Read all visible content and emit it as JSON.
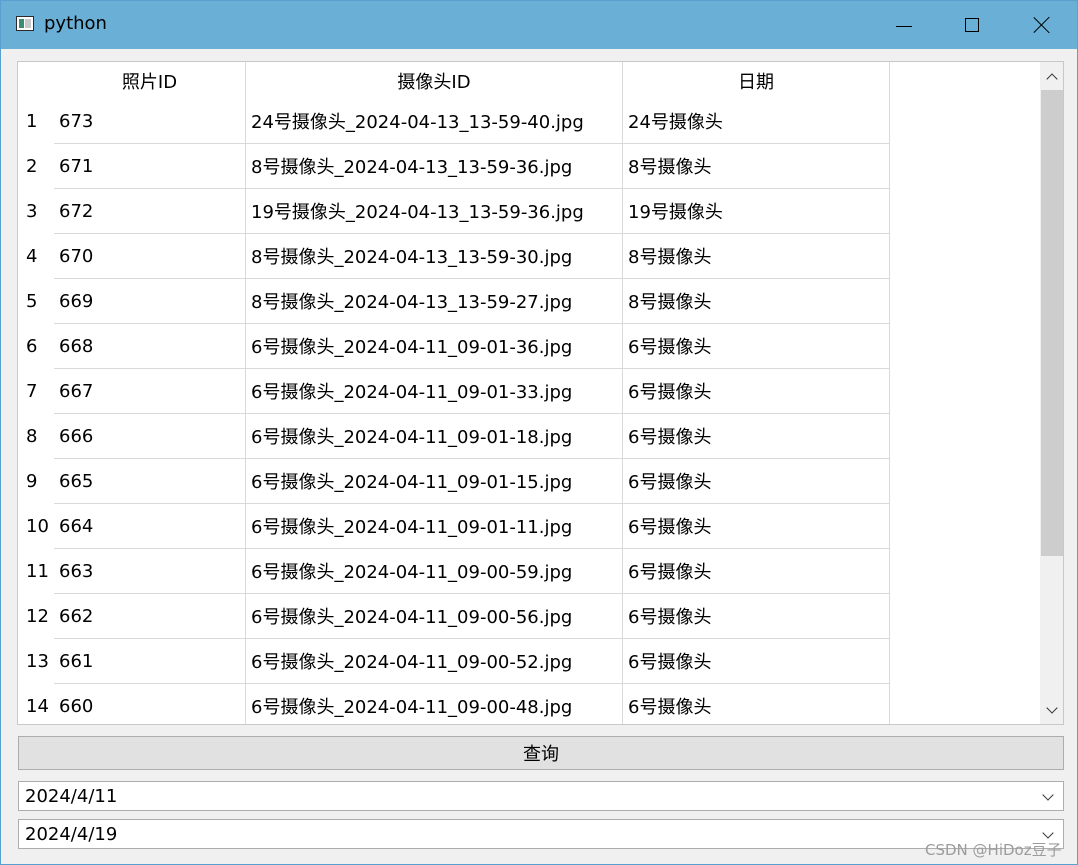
{
  "window": {
    "title": "python"
  },
  "table": {
    "columns": [
      "照片ID",
      "摄像头ID",
      "日期"
    ],
    "rows": [
      {
        "num": "1",
        "photo_id": "673",
        "camera_file": "24号摄像头_2024-04-13_13-59-40.jpg",
        "camera": "24号摄像头"
      },
      {
        "num": "2",
        "photo_id": "671",
        "camera_file": "8号摄像头_2024-04-13_13-59-36.jpg",
        "camera": "8号摄像头"
      },
      {
        "num": "3",
        "photo_id": "672",
        "camera_file": "19号摄像头_2024-04-13_13-59-36.jpg",
        "camera": "19号摄像头"
      },
      {
        "num": "4",
        "photo_id": "670",
        "camera_file": "8号摄像头_2024-04-13_13-59-30.jpg",
        "camera": "8号摄像头"
      },
      {
        "num": "5",
        "photo_id": "669",
        "camera_file": "8号摄像头_2024-04-13_13-59-27.jpg",
        "camera": "8号摄像头"
      },
      {
        "num": "6",
        "photo_id": "668",
        "camera_file": "6号摄像头_2024-04-11_09-01-36.jpg",
        "camera": "6号摄像头"
      },
      {
        "num": "7",
        "photo_id": "667",
        "camera_file": "6号摄像头_2024-04-11_09-01-33.jpg",
        "camera": "6号摄像头"
      },
      {
        "num": "8",
        "photo_id": "666",
        "camera_file": "6号摄像头_2024-04-11_09-01-18.jpg",
        "camera": "6号摄像头"
      },
      {
        "num": "9",
        "photo_id": "665",
        "camera_file": "6号摄像头_2024-04-11_09-01-15.jpg",
        "camera": "6号摄像头"
      },
      {
        "num": "10",
        "photo_id": "664",
        "camera_file": "6号摄像头_2024-04-11_09-01-11.jpg",
        "camera": "6号摄像头"
      },
      {
        "num": "11",
        "photo_id": "663",
        "camera_file": "6号摄像头_2024-04-11_09-00-59.jpg",
        "camera": "6号摄像头"
      },
      {
        "num": "12",
        "photo_id": "662",
        "camera_file": "6号摄像头_2024-04-11_09-00-56.jpg",
        "camera": "6号摄像头"
      },
      {
        "num": "13",
        "photo_id": "661",
        "camera_file": "6号摄像头_2024-04-11_09-00-52.jpg",
        "camera": "6号摄像头"
      },
      {
        "num": "14",
        "photo_id": "660",
        "camera_file": "6号摄像头_2024-04-11_09-00-48.jpg",
        "camera": "6号摄像头"
      }
    ]
  },
  "controls": {
    "query_label": "查询",
    "start_date": "2024/4/11",
    "end_date": "2024/4/19"
  },
  "watermark": "CSDN @HiDoz豆子",
  "colors": {
    "titlebar": "#6aafd6",
    "window_bg": "#f0f0f0",
    "grid_line": "#d9d9d9",
    "scroll_thumb": "#cdcdcd"
  },
  "icons": [
    "app-icon",
    "minimize-icon",
    "maximize-icon",
    "close-icon",
    "scroll-up-icon",
    "scroll-down-icon",
    "chevron-down-icon"
  ]
}
